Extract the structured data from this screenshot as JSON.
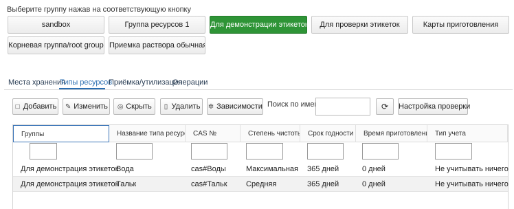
{
  "prompt": "Выберите группу нажав на соответствующую кнопку",
  "groups": [
    {
      "label": "sandbox",
      "active": false
    },
    {
      "label": "Группа ресурсов 1",
      "active": false
    },
    {
      "label": "Для демонстрации этикеток",
      "active": true
    },
    {
      "label": "Для проверки этикеток",
      "active": false
    },
    {
      "label": "Карты приготовления",
      "active": false
    },
    {
      "label": "Корневая группа/root group",
      "active": false
    },
    {
      "label": "Приемка раствора обычная",
      "active": false
    }
  ],
  "tabs": [
    {
      "label": "Места хранения",
      "active": false
    },
    {
      "label": "Типы ресурсов",
      "active": true
    },
    {
      "label": "Приёмка/утилизация",
      "active": false
    },
    {
      "label": "Операции",
      "active": false
    }
  ],
  "toolbar": {
    "add": "Добавить",
    "edit": "Изменить",
    "hide": "Скрыть",
    "delete": "Удалить",
    "dependencies": "Зависимости",
    "search_label": "Поиск по имени",
    "search_value": "",
    "check_settings": "Настройка проверки"
  },
  "table": {
    "columns": [
      "Группы",
      "Название типа ресурса",
      "CAS №",
      "Степень чистоты",
      "Срок годности",
      "Время приготовления",
      "Тип учета"
    ],
    "rows": [
      [
        "Для демонстрация этикеток",
        "Вода",
        "cas#Воды",
        "Максимальная",
        "365 дней",
        "0 дней",
        "Не учитывать ничего"
      ],
      [
        "Для демонстрация этикеток",
        "Тальк",
        "cas#Тальк",
        "Средняя",
        "365 дней",
        "0 дней",
        "Не учитывать ничего"
      ]
    ]
  },
  "colors": {
    "active_button": "#2e9436",
    "tab_active": "#2a6db0",
    "header_selected_border": "#3b75b8"
  }
}
